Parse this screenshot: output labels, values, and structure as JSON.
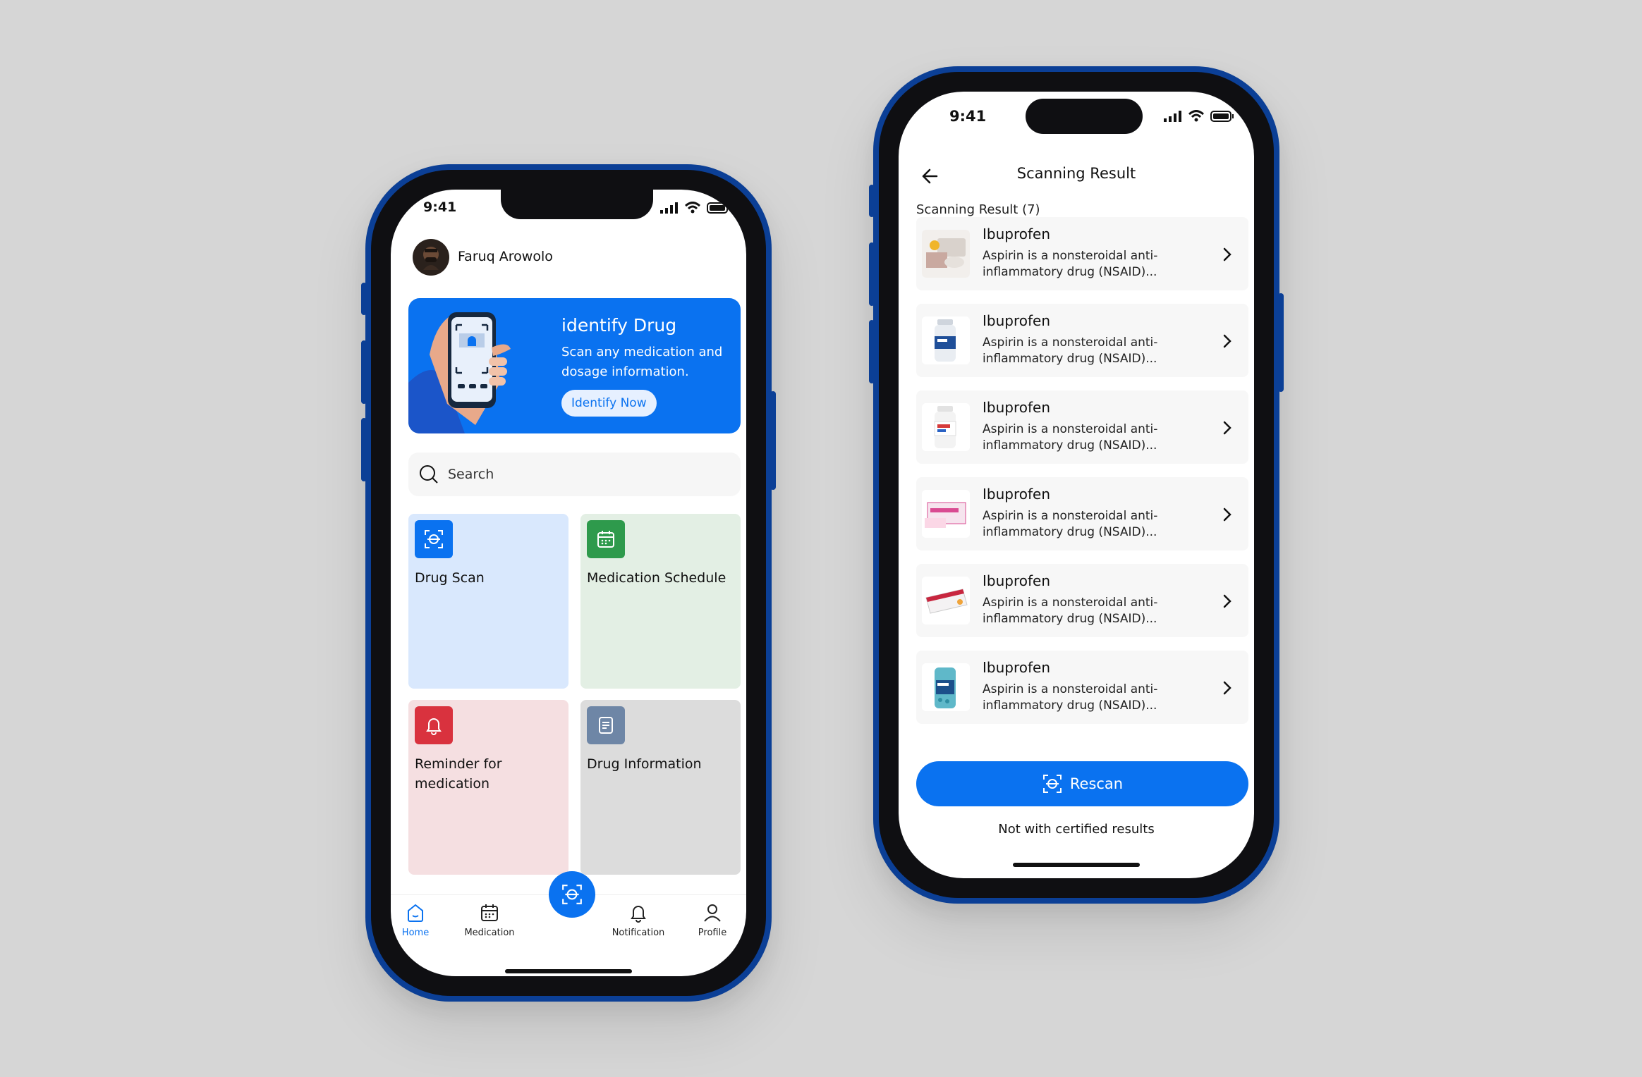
{
  "colors": {
    "background": "#d6d6d6",
    "accent": "#0a72f0",
    "phone_frame": "#0b3f96"
  },
  "home_screen": {
    "status_time": "9:41",
    "user": {
      "name": "Faruq Arowolo"
    },
    "banner": {
      "title": "identify Drug",
      "description": "Scan any medication and dosage information.",
      "button_label": "Identify Now"
    },
    "search": {
      "placeholder": "Search"
    },
    "tiles": [
      {
        "label": "Drug Scan",
        "icon": "scan-icon",
        "bg": "#d9e8fd",
        "icon_bg": "#0a72f0"
      },
      {
        "label": "Medication Schedule",
        "icon": "calendar-icon",
        "bg": "#e3efe4",
        "icon_bg": "#2e9a4c"
      },
      {
        "label": "Reminder for medication",
        "icon": "bell-icon",
        "bg": "#f5dfe1",
        "icon_bg": "#d9323e"
      },
      {
        "label": "Drug Information",
        "icon": "document-icon",
        "bg": "#dcdcdc",
        "icon_bg": "#6e86a6"
      }
    ],
    "nav": [
      {
        "label": "Home",
        "icon": "home-icon",
        "active": true
      },
      {
        "label": "Medication",
        "icon": "calendar-icon",
        "active": false
      },
      {
        "label": "Notification",
        "icon": "bell-icon",
        "active": false
      },
      {
        "label": "Profile",
        "icon": "user-icon",
        "active": false
      }
    ],
    "fab_icon": "scan-icon"
  },
  "result_screen": {
    "status_time": "9:41",
    "title": "Scanning Result",
    "count_label": "Scanning Result (7)",
    "results": [
      {
        "name": "Ibuprofen",
        "description": "Aspirin is a nonsteroidal anti-inflammatory drug (NSAID)..."
      },
      {
        "name": "Ibuprofen",
        "description": "Aspirin is a nonsteroidal anti-inflammatory drug (NSAID)..."
      },
      {
        "name": "Ibuprofen",
        "description": "Aspirin is a nonsteroidal anti-inflammatory drug (NSAID)..."
      },
      {
        "name": "Ibuprofen",
        "description": "Aspirin is a nonsteroidal anti-inflammatory drug (NSAID)..."
      },
      {
        "name": "Ibuprofen",
        "description": "Aspirin is a nonsteroidal anti-inflammatory drug (NSAID)..."
      },
      {
        "name": "Ibuprofen",
        "description": "Aspirin is a nonsteroidal anti-inflammatory drug (NSAID)..."
      }
    ],
    "rescan_label": "Rescan",
    "footnote": "Not with certified results"
  }
}
